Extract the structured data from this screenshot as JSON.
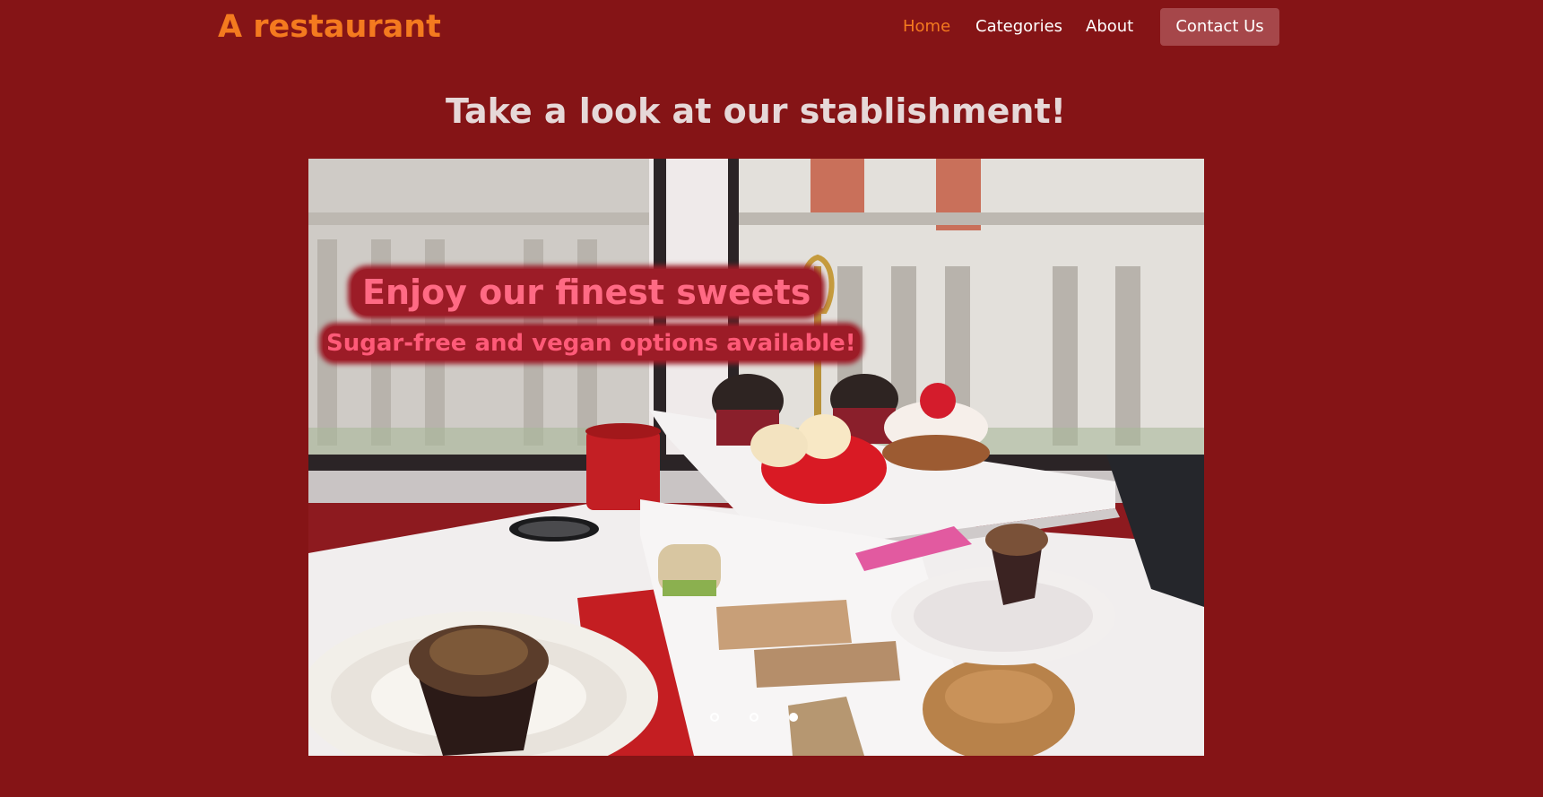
{
  "header": {
    "brand": "A restaurant",
    "nav": {
      "home": "Home",
      "categories": "Categories",
      "about": "About",
      "contact": "Contact Us"
    },
    "active_item": "Home"
  },
  "main": {
    "headline": "Take a look at our stablishment!",
    "carousel": {
      "slide_count": 3,
      "active_slide": 3,
      "caption_title": "Enjoy our finest sweets",
      "caption_subtitle": "Sugar-free and vegan options available!"
    }
  },
  "colors": {
    "background": "#851416",
    "brand": "#f47a1f",
    "contact_button": "#a6474a",
    "caption_bg": "#9c1c27",
    "caption_text": "#ff6a84"
  }
}
